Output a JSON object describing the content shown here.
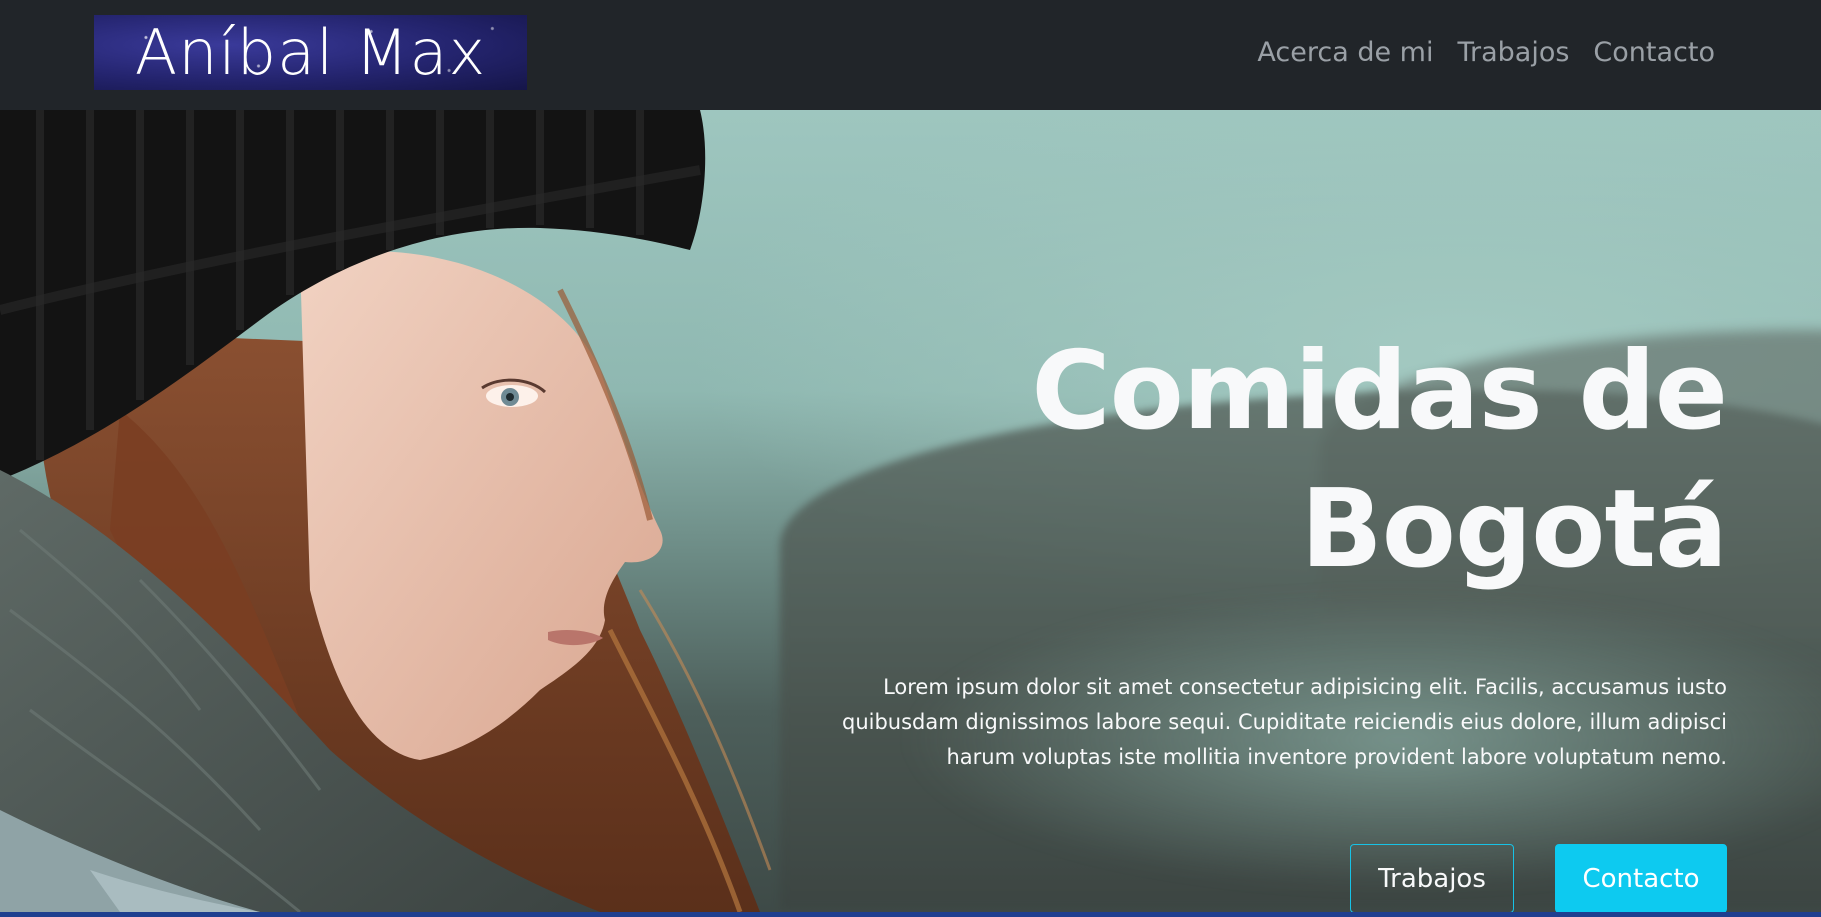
{
  "navbar": {
    "logo_text": "Aníbal Max",
    "links": [
      {
        "label": "Acerca de mi"
      },
      {
        "label": "Trabajos"
      },
      {
        "label": "Contacto"
      }
    ]
  },
  "hero": {
    "title_line1": "Comidas de",
    "title_line2": "Bogotá",
    "description": "Lorem ipsum dolor sit amet consectetur adipisicing elit. Facilis, accusamus iusto quibusdam dignissimos labore sequi. Cupiditate reiciendis eius dolore, illum adipisci harum voluptas iste mollitia inventore provident labore voluptatum nemo.",
    "buttons": {
      "secondary_label": "Trabajos",
      "primary_label": "Contacto"
    },
    "background_image": "woman-portrait-photo"
  },
  "colors": {
    "navbar_bg": "#212529",
    "accent": "#0dcaf0",
    "text_light": "#f8f9fa",
    "nav_link": "#9aa0a6"
  }
}
